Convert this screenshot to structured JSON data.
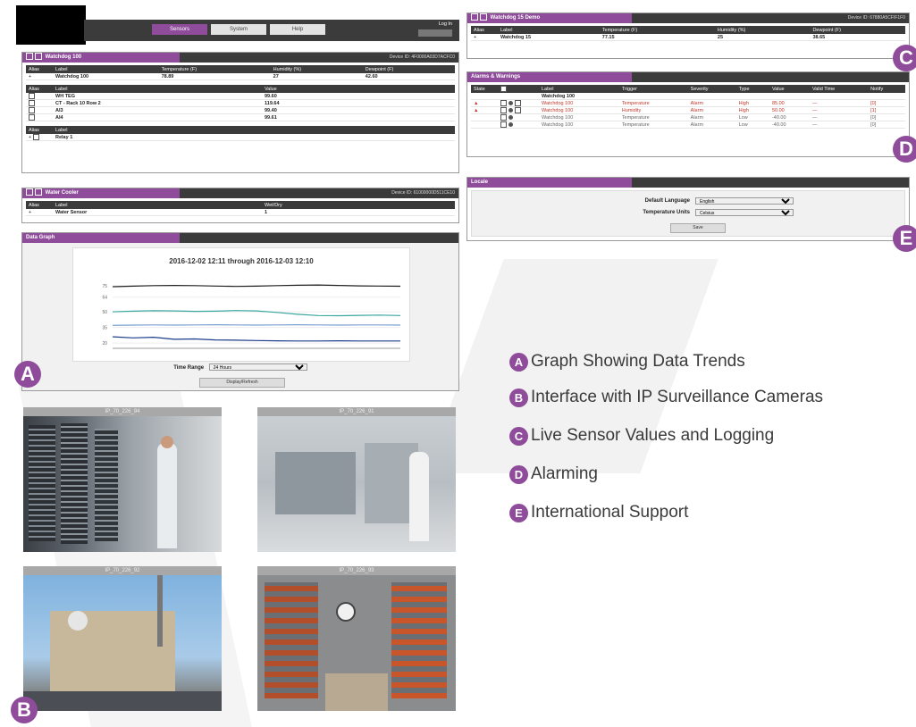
{
  "nav": {
    "tabs": [
      "Sensors",
      "System",
      "Help"
    ],
    "login": "Log In"
  },
  "watchdog100": {
    "title": "Watchdog 100",
    "device_id": "Device ID: 4F0000A03D7ACFC0",
    "headers": [
      "Alias",
      "Label",
      "Temperature (F)",
      "Humidity (%)",
      "Dewpoint (F)"
    ],
    "row": {
      "alias": "+",
      "label": "Watchdog 100",
      "temp": "78.89",
      "humidity": "27",
      "dewpoint": "42.60"
    },
    "sub_headers": [
      "Alias",
      "Label",
      "Value"
    ],
    "sub_rows": [
      {
        "label": "WH TEG",
        "value": "99.60"
      },
      {
        "label": "CT - Rack 10 Row 2",
        "value": "119.64"
      },
      {
        "label": "AI3",
        "value": "99.40"
      },
      {
        "label": "AI4",
        "value": "99.61"
      }
    ],
    "relay_headers": [
      "Alias",
      "Label"
    ],
    "relay": "Relay 1"
  },
  "water_cooler": {
    "title": "Water Cooler",
    "device_id": "Device ID: 61000000D511CE10",
    "headers": [
      "Alias",
      "Label",
      "Wet/Dry"
    ],
    "row": {
      "alias": "+",
      "label": "Water Sensor",
      "value": "1"
    }
  },
  "data_graph": {
    "tab": "Data Graph",
    "title": "2016-12-02 12:11 through 2016-12-03 12:10",
    "y_ticks": [
      "75",
      "64",
      "50",
      "35",
      "20"
    ],
    "time_range_label": "Time Range",
    "time_range_value": "24 Hours",
    "refresh_label": "Display/Refresh"
  },
  "chart_data": {
    "type": "line",
    "title": "2016-12-02 12:11 through 2016-12-03 12:10",
    "ylim": [
      15,
      80
    ],
    "series": [
      {
        "name": "",
        "color": "#222222",
        "values": [
          74,
          74.5,
          75,
          75.2,
          75,
          74.6,
          74.3,
          74.5,
          75,
          75.4,
          75.6,
          75.2,
          74.8,
          74.6,
          74.4
        ]
      },
      {
        "name": "",
        "color": "#3aa6a0",
        "values": [
          50,
          50.6,
          51,
          50.8,
          50.4,
          50.6,
          51.2,
          50.8,
          49.4,
          47.6,
          46.4,
          46.2,
          46.6,
          46.8,
          46.4
        ]
      },
      {
        "name": "",
        "color": "#7a9fd0",
        "values": [
          37,
          37.2,
          37.4,
          37.2,
          37.4,
          37.6,
          37.4,
          37.2,
          37.4,
          37.6,
          37.4,
          37.2,
          37.4,
          37.4,
          37.2
        ]
      },
      {
        "name": "",
        "color": "#1c3b8a",
        "values": [
          26,
          25,
          25.6,
          23.6,
          24,
          23,
          22.8,
          22.4,
          22.2,
          22,
          22,
          22.2,
          22,
          22,
          22
        ]
      }
    ]
  },
  "watchdog15": {
    "title": "Watchdog 15 Demo",
    "device_id": "Device ID: 67880A5CFIF1F0",
    "headers": [
      "Alias",
      "Label",
      "Temperature (F)",
      "Humidity (%)",
      "Dewpoint (F)"
    ],
    "row": {
      "alias": "+",
      "label": "Watchdog 15",
      "temp": "77.15",
      "humidity": "25",
      "dewpoint": "38.65"
    }
  },
  "alarms": {
    "title": "Alarms & Warnings",
    "headers": [
      "State",
      "",
      "Label",
      "Trigger",
      "Severity",
      "Type",
      "Value",
      "Valid Time",
      "Notify"
    ],
    "group": "Watchdog 100",
    "rows": [
      {
        "state": "▲",
        "label": "Watchdog 100",
        "trigger": "Temperature",
        "severity": "Alarm",
        "type": "High",
        "value": "85.00",
        "valid": "—",
        "notify": "[0]",
        "active": true
      },
      {
        "state": "▲",
        "label": "Watchdog 100",
        "trigger": "Humidity",
        "severity": "Alarm",
        "type": "High",
        "value": "50.00",
        "valid": "—",
        "notify": "[1]",
        "active": true
      },
      {
        "state": "",
        "label": "Watchdog 100",
        "trigger": "Temperature",
        "severity": "Alarm",
        "type": "Low",
        "value": "-40.00",
        "valid": "—",
        "notify": "[0]",
        "active": false
      },
      {
        "state": "",
        "label": "Watchdog 100",
        "trigger": "Temperature",
        "severity": "Alarm",
        "type": "Low",
        "value": "-40.00",
        "valid": "—",
        "notify": "[0]",
        "active": false
      }
    ]
  },
  "locale": {
    "title": "Locale",
    "default_language_label": "Default Language",
    "default_language_value": "English",
    "temperature_units_label": "Temperature Units",
    "temperature_units_value": "Celsius",
    "save_label": "Save"
  },
  "cameras": [
    "IP_70_226_94",
    "IP_70_226_91",
    "IP_70_226_92",
    "IP_70_226_93"
  ],
  "callouts": {
    "a": "A",
    "b": "B",
    "c": "C",
    "d": "D",
    "e": "E"
  },
  "legend": [
    {
      "letter": "A",
      "text": "Graph Showing Data Trends"
    },
    {
      "letter": "B",
      "text": "Interface with IP Surveillance Cameras"
    },
    {
      "letter": "C",
      "text": "Live Sensor Values and Logging"
    },
    {
      "letter": "D",
      "text": "Alarming"
    },
    {
      "letter": "E",
      "text": "International Support"
    }
  ],
  "colors": {
    "accent": "#8e4c9a",
    "header": "#3b3b3b"
  }
}
